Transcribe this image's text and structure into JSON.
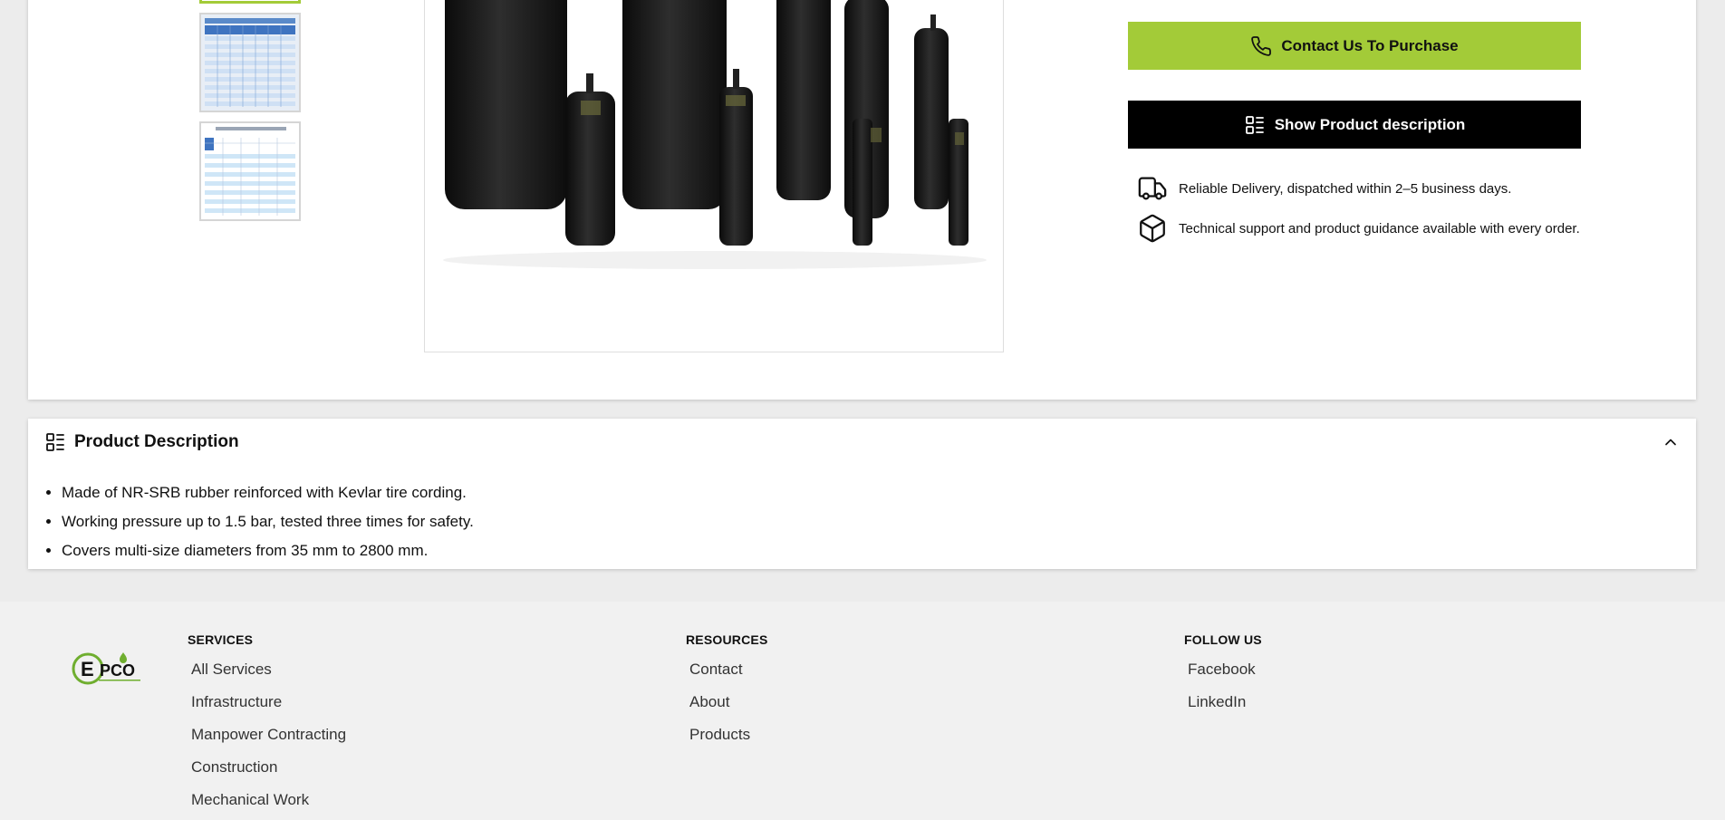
{
  "product": {
    "buttons": {
      "contact": "Contact Us To Purchase",
      "show_description": "Show Product description"
    },
    "features": [
      {
        "icon": "truck-icon",
        "text": "Reliable Delivery, dispatched within 2–5 business days."
      },
      {
        "icon": "box-icon",
        "text": "Technical support and product guidance available with every order."
      }
    ],
    "accent_color": "#a3cb38"
  },
  "description": {
    "title": "Product Description",
    "items": [
      "Made of NR-SRB rubber reinforced with Kevlar tire cording.",
      "Working pressure up to 1.5 bar, tested three times for safety.",
      "Covers multi-size diameters from 35 mm to 2800 mm."
    ]
  },
  "footer": {
    "services": {
      "heading": "SERVICES",
      "links": [
        "All Services",
        "Infrastructure",
        "Manpower Contracting",
        "Construction",
        "Mechanical Work"
      ]
    },
    "resources": {
      "heading": "RESOURCES",
      "links": [
        "Contact",
        "About",
        "Products"
      ]
    },
    "follow": {
      "heading": "FOLLOW US",
      "links": [
        "Facebook",
        "LinkedIn"
      ]
    },
    "logo_text": "EPCO"
  }
}
